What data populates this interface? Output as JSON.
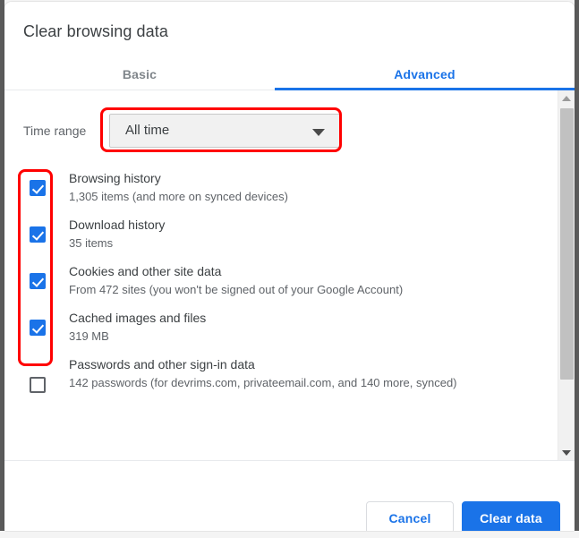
{
  "window": {
    "dialog_title": "Clear browsing data"
  },
  "tabs": [
    {
      "label": "Basic",
      "active": false
    },
    {
      "label": "Advanced",
      "active": true
    }
  ],
  "time_range": {
    "label": "Time range",
    "selected": "All time",
    "caret_icon": "chevron-down-icon",
    "highlighted": true
  },
  "options": [
    {
      "title": "Browsing history",
      "subtitle": "1,305 items (and more on synced devices)",
      "checked": true
    },
    {
      "title": "Download history",
      "subtitle": "35 items",
      "checked": true
    },
    {
      "title": "Cookies and other site data",
      "subtitle": "From 472 sites (you won't be signed out of your Google Account)",
      "checked": true
    },
    {
      "title": "Cached images and files",
      "subtitle": "319 MB",
      "checked": true
    },
    {
      "title": "Passwords and other sign-in data",
      "subtitle": "142 passwords (for devrims.com, privateemail.com, and 140 more, synced)",
      "checked": false
    }
  ],
  "scrollbar": {
    "up_arrow_icon": "scroll-up-arrow-icon",
    "down_arrow_icon": "scroll-down-arrow-icon"
  },
  "footer": {
    "cancel_label": "Cancel",
    "clear_label": "Clear data"
  },
  "colors": {
    "accent": "#1a73e8",
    "annotation": "#ff0000",
    "title_text": "#3c4043",
    "sub_text": "#5f6368",
    "inactive_tab": "#80868b"
  }
}
